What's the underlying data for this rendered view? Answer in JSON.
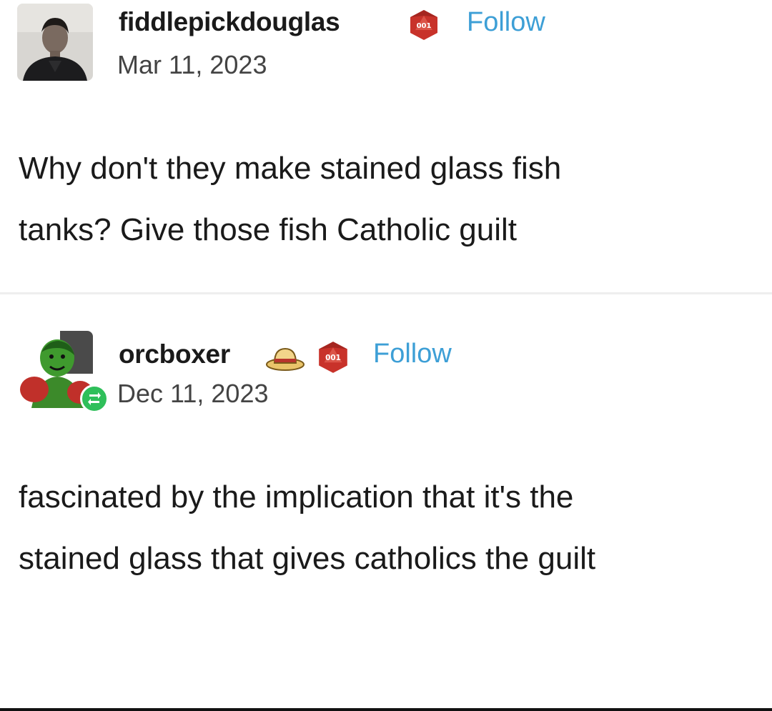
{
  "posts": [
    {
      "username": "fiddlepickdouglas",
      "date": "Mar 11, 2023",
      "follow_label": "Follow",
      "badges": [
        "d20-die-icon"
      ],
      "text_lines": [
        "Why don't they make stained glass fish",
        "tanks? Give those fish Catholic guilt"
      ]
    },
    {
      "username": "orcboxer",
      "date": "Dec 11, 2023",
      "follow_label": "Follow",
      "badges": [
        "straw-hat-icon",
        "d20-die-icon"
      ],
      "reblog_indicator": "reblog-icon",
      "text_lines": [
        "fascinated by the implication that it's the",
        "stained glass that gives catholics the guilt"
      ]
    }
  ],
  "colors": {
    "follow": "#3d9fd6",
    "d20_badge": "#c8322a",
    "reblog_badge": "#2fbf5a",
    "divider": "#eeeeee"
  }
}
